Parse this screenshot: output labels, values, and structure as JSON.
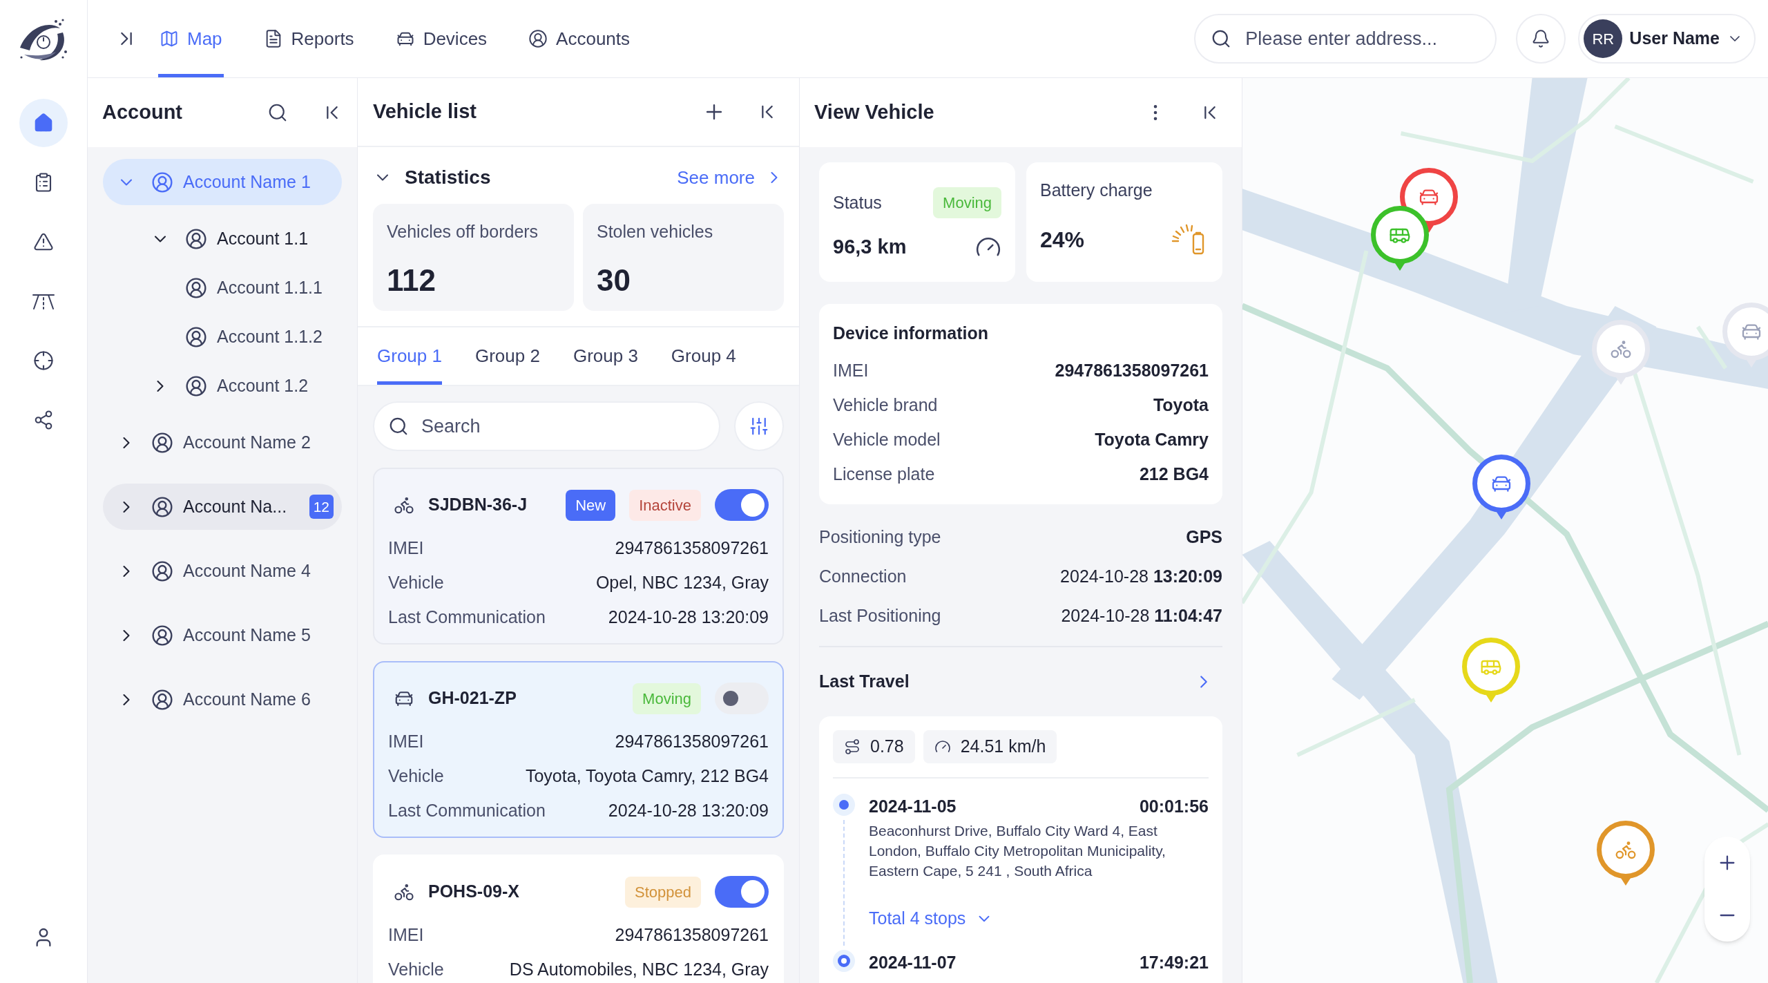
{
  "nav": {
    "tabs": [
      {
        "label": "Map",
        "kind": "map",
        "selected": true
      },
      {
        "label": "Reports",
        "kind": "file",
        "selected": false
      },
      {
        "label": "Devices",
        "kind": "car",
        "selected": false
      },
      {
        "label": "Accounts",
        "kind": "user",
        "selected": false
      }
    ]
  },
  "search": {
    "placeholder": "Please enter address..."
  },
  "user": {
    "initials": "RR",
    "name": "User Name"
  },
  "rail": [
    {
      "kind": "home",
      "selected": true
    },
    {
      "kind": "clipboard",
      "selected": false
    },
    {
      "kind": "alert",
      "selected": false
    },
    {
      "kind": "road",
      "selected": false
    },
    {
      "kind": "target",
      "selected": false
    },
    {
      "kind": "share",
      "selected": false
    }
  ],
  "account_panel": {
    "title": "Account",
    "tree": [
      {
        "label": "Account Name 1",
        "expanded": true,
        "selected": true,
        "hovered": false,
        "children": [
          {
            "label": "Account 1.1",
            "expanded": true,
            "selected": false,
            "children": [
              {
                "label": "Account 1.1.1",
                "selected": false
              },
              {
                "label": "Account 1.1.2",
                "selected": false
              }
            ]
          },
          {
            "label": "Account 1.2",
            "expanded": false,
            "selected": false
          }
        ]
      },
      {
        "label": "Account Name 2",
        "expanded": false,
        "selected": false,
        "hovered": false
      },
      {
        "label": "Account Na...",
        "expanded": false,
        "selected": false,
        "hovered": true,
        "badge": "12"
      },
      {
        "label": "Account Name 4",
        "expanded": false,
        "selected": false,
        "hovered": false
      },
      {
        "label": "Account Name 5",
        "expanded": false,
        "selected": false,
        "hovered": false
      },
      {
        "label": "Account Name 6",
        "expanded": false,
        "selected": false,
        "hovered": false
      }
    ]
  },
  "vehicle_list": {
    "title": "Vehicle list",
    "statistics": {
      "title": "Statistics",
      "expanded": true,
      "link": "See more",
      "cards": [
        {
          "label": "Vehicles off borders",
          "value": "112"
        },
        {
          "label": "Stolen vehicles",
          "value": "30"
        }
      ]
    },
    "groups": [
      {
        "label": "Group 1",
        "selected": true
      },
      {
        "label": "Group 2",
        "selected": false
      },
      {
        "label": "Group 3",
        "selected": false
      },
      {
        "label": "Group 4",
        "selected": false
      }
    ],
    "search": {
      "placeholder": "Search"
    },
    "vehicles": [
      {
        "kind": "motorbike",
        "plate": "SJDBN-36-J",
        "selected": false,
        "on": true,
        "badges": [
          {
            "text": "New",
            "kind": "new"
          },
          {
            "text": "Inactive",
            "kind": "inactive"
          }
        ],
        "fields": [
          {
            "label": "IMEI",
            "value": "2947861358097261"
          },
          {
            "label": "Vehicle",
            "value": "Opel, NBC 1234, Gray"
          },
          {
            "label": "Last Communication",
            "value": "2024-10-28 13:20:09"
          }
        ]
      },
      {
        "kind": "car",
        "plate": "GH-021-ZP",
        "selected": true,
        "on": false,
        "badges": [
          {
            "text": "Moving",
            "kind": "moving"
          }
        ],
        "fields": [
          {
            "label": "IMEI",
            "value": "2947861358097261"
          },
          {
            "label": "Vehicle",
            "value": "Toyota, Toyota Camry, 212 BG4"
          },
          {
            "label": "Last Communication",
            "value": "2024-10-28 13:20:09"
          }
        ]
      },
      {
        "kind": "bicycle",
        "plate": "POHS-09-X",
        "selected": false,
        "on": true,
        "badges": [
          {
            "text": "Stopped",
            "kind": "stopped"
          }
        ],
        "fields": [
          {
            "label": "IMEI",
            "value": "2947861358097261"
          },
          {
            "label": "Vehicle",
            "value": "DS Automobiles, NBC 1234, Gray"
          }
        ]
      }
    ]
  },
  "view_vehicle": {
    "title": "View Vehicle",
    "status": {
      "label": "Status",
      "badge": "Moving",
      "value": "96,3 km"
    },
    "battery": {
      "label": "Battery charge",
      "value": "24%"
    },
    "device_info": {
      "title": "Device information",
      "rows": [
        {
          "label": "IMEI",
          "value": "2947861358097261"
        },
        {
          "label": "Vehicle brand",
          "value": "Toyota"
        },
        {
          "label": "Vehicle model",
          "value": "Toyota Camry"
        },
        {
          "label": "License plate",
          "value": "212 BG4"
        }
      ]
    },
    "info_rows": [
      {
        "label": "Positioning type",
        "value": "**GPS**"
      },
      {
        "label": "Connection",
        "value": "2024-10-28 **13:20:09**"
      },
      {
        "label": "Last Positioning",
        "value": "2024-10-28 **11:04:47**"
      }
    ],
    "last_travel": {
      "title": "Last Travel",
      "chips": [
        {
          "kind": "distance",
          "text": "0.78"
        },
        {
          "kind": "speed",
          "text": "24.51 km/h"
        }
      ],
      "stops": [
        {
          "kind": "start",
          "date": "2024-11-05",
          "time": "00:01:56",
          "address": "Beaconhurst Drive, Buffalo City Ward 4, East London, Buffalo City Metropolitan Municipality, Eastern Cape, 5 241 , South Africa",
          "link": "Total 4 stops"
        },
        {
          "kind": "end",
          "date": "2024-11-07",
          "time": "17:49:21"
        }
      ]
    }
  },
  "map": {
    "pins": [
      {
        "kind": "car",
        "color": "#ef4444"
      },
      {
        "kind": "bus",
        "color": "#3cc12a"
      },
      {
        "kind": "bicycle",
        "color": "#e5e7ef"
      },
      {
        "kind": "car",
        "color": "#e5e7ef"
      },
      {
        "kind": "car",
        "color": "#4a6cf7"
      },
      {
        "kind": "bus",
        "color": "#e6d81a"
      },
      {
        "kind": "bicycle",
        "color": "#e0962a"
      }
    ]
  }
}
